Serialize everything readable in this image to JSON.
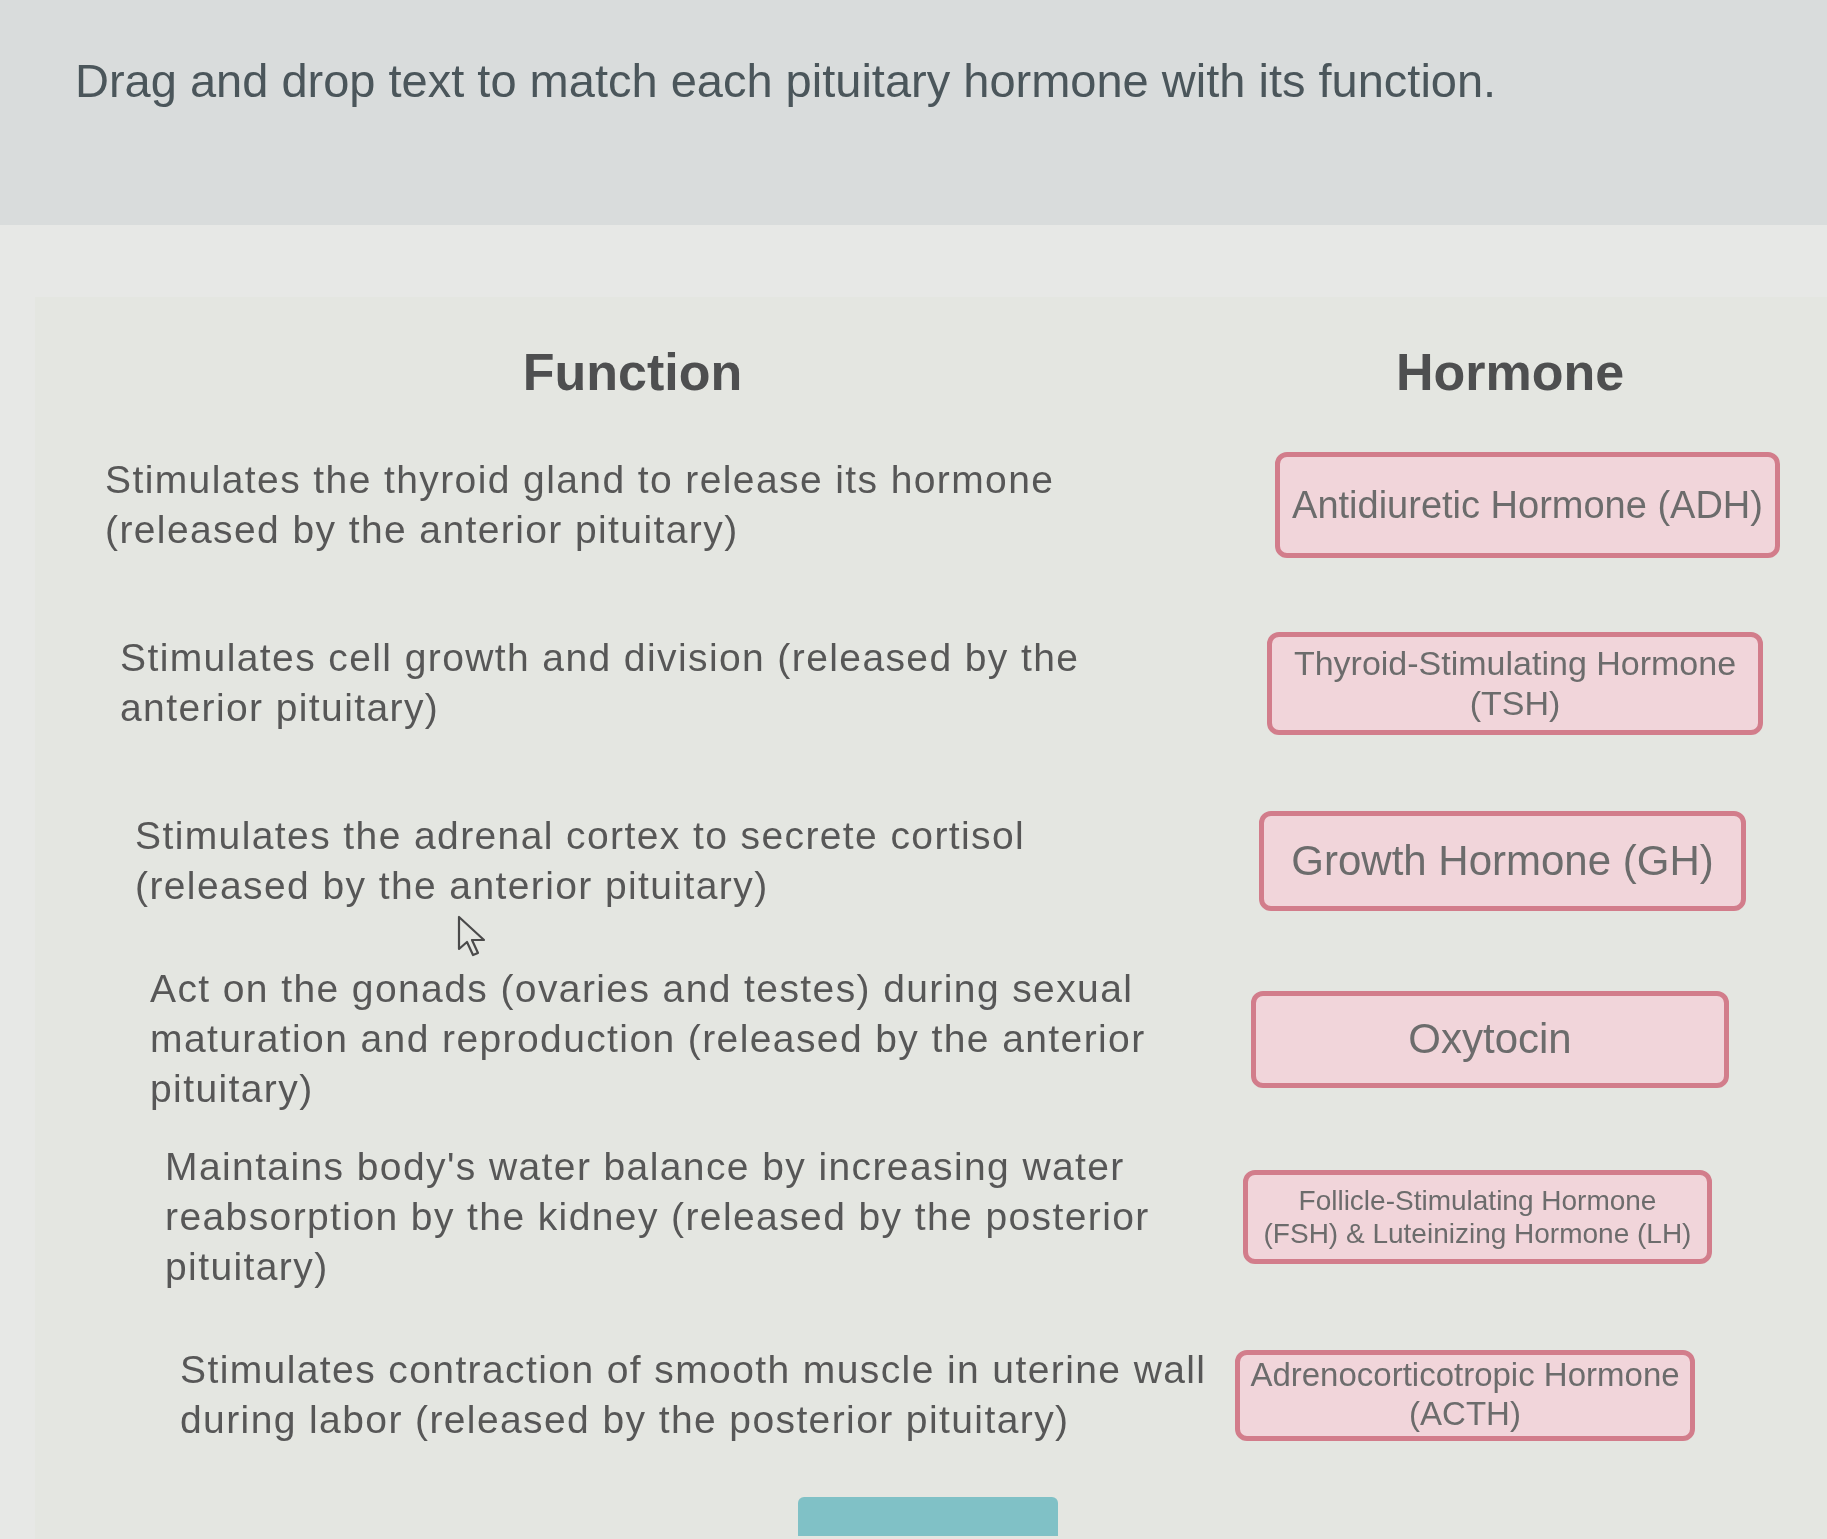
{
  "instruction": "Drag and drop text to match each pituitary hormone with its function.",
  "column_headings": {
    "function": "Function",
    "hormone": "Hormone"
  },
  "functions": [
    {
      "lines": [
        "Stimulates the thyroid gland to release its hormone",
        "(released by the anterior pituitary)"
      ]
    },
    {
      "lines": [
        "Stimulates cell growth and division (released by the",
        "anterior pituitary)"
      ]
    },
    {
      "lines": [
        "Stimulates the adrenal cortex to secrete cortisol",
        "(released by the anterior pituitary)"
      ]
    },
    {
      "lines": [
        "Act on the gonads (ovaries and testes) during sexual",
        "maturation and reproduction (released by the anterior",
        "pituitary)"
      ]
    },
    {
      "lines": [
        "Maintains body's water balance by increasing water",
        "reabsorption by the kidney (released by the posterior",
        "pituitary)"
      ]
    },
    {
      "lines": [
        "Stimulates contraction of smooth muscle in uterine wall",
        "during labor (released by the posterior pituitary)"
      ]
    }
  ],
  "hormones": [
    {
      "lines": [
        "Antidiuretic Hormone (ADH)"
      ]
    },
    {
      "lines": [
        "Thyroid-Stimulating Hormone",
        "(TSH)"
      ]
    },
    {
      "lines": [
        "Growth Hormone (GH)"
      ]
    },
    {
      "lines": [
        "Oxytocin"
      ]
    },
    {
      "lines": [
        "Follicle-Stimulating Hormone",
        "(FSH) & Luteinizing Hormone (LH)"
      ]
    },
    {
      "lines": [
        "Adrenocorticotropic Hormone",
        "(ACTH)"
      ]
    }
  ]
}
